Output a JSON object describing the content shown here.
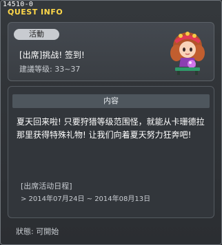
{
  "window": {
    "id_label": "14510-0",
    "title": "QUEST INFO"
  },
  "quest": {
    "tag": "活動",
    "name": "[出席]挑战! 签到!",
    "level_text": "建議等级: 33~37"
  },
  "content": {
    "section_title": "内容",
    "description": "夏天回来啦! 只要狩猎等级范围怪，就能从卡珊德拉那里获得特殊礼物! 让我们向着夏天努力狂奔吧!",
    "schedule_title": "[出席活动日程]",
    "schedule_range": "> 2014年07月24日 ~ 2014年08月13日"
  },
  "status": {
    "text": "狀態: 可開始"
  },
  "colors": {
    "title_accent": "#ffd84a",
    "panel_bg": "#3a3e43",
    "tag_bg": "#c8cbd0"
  },
  "icons": {
    "npc": "npc-portrait-icon"
  }
}
